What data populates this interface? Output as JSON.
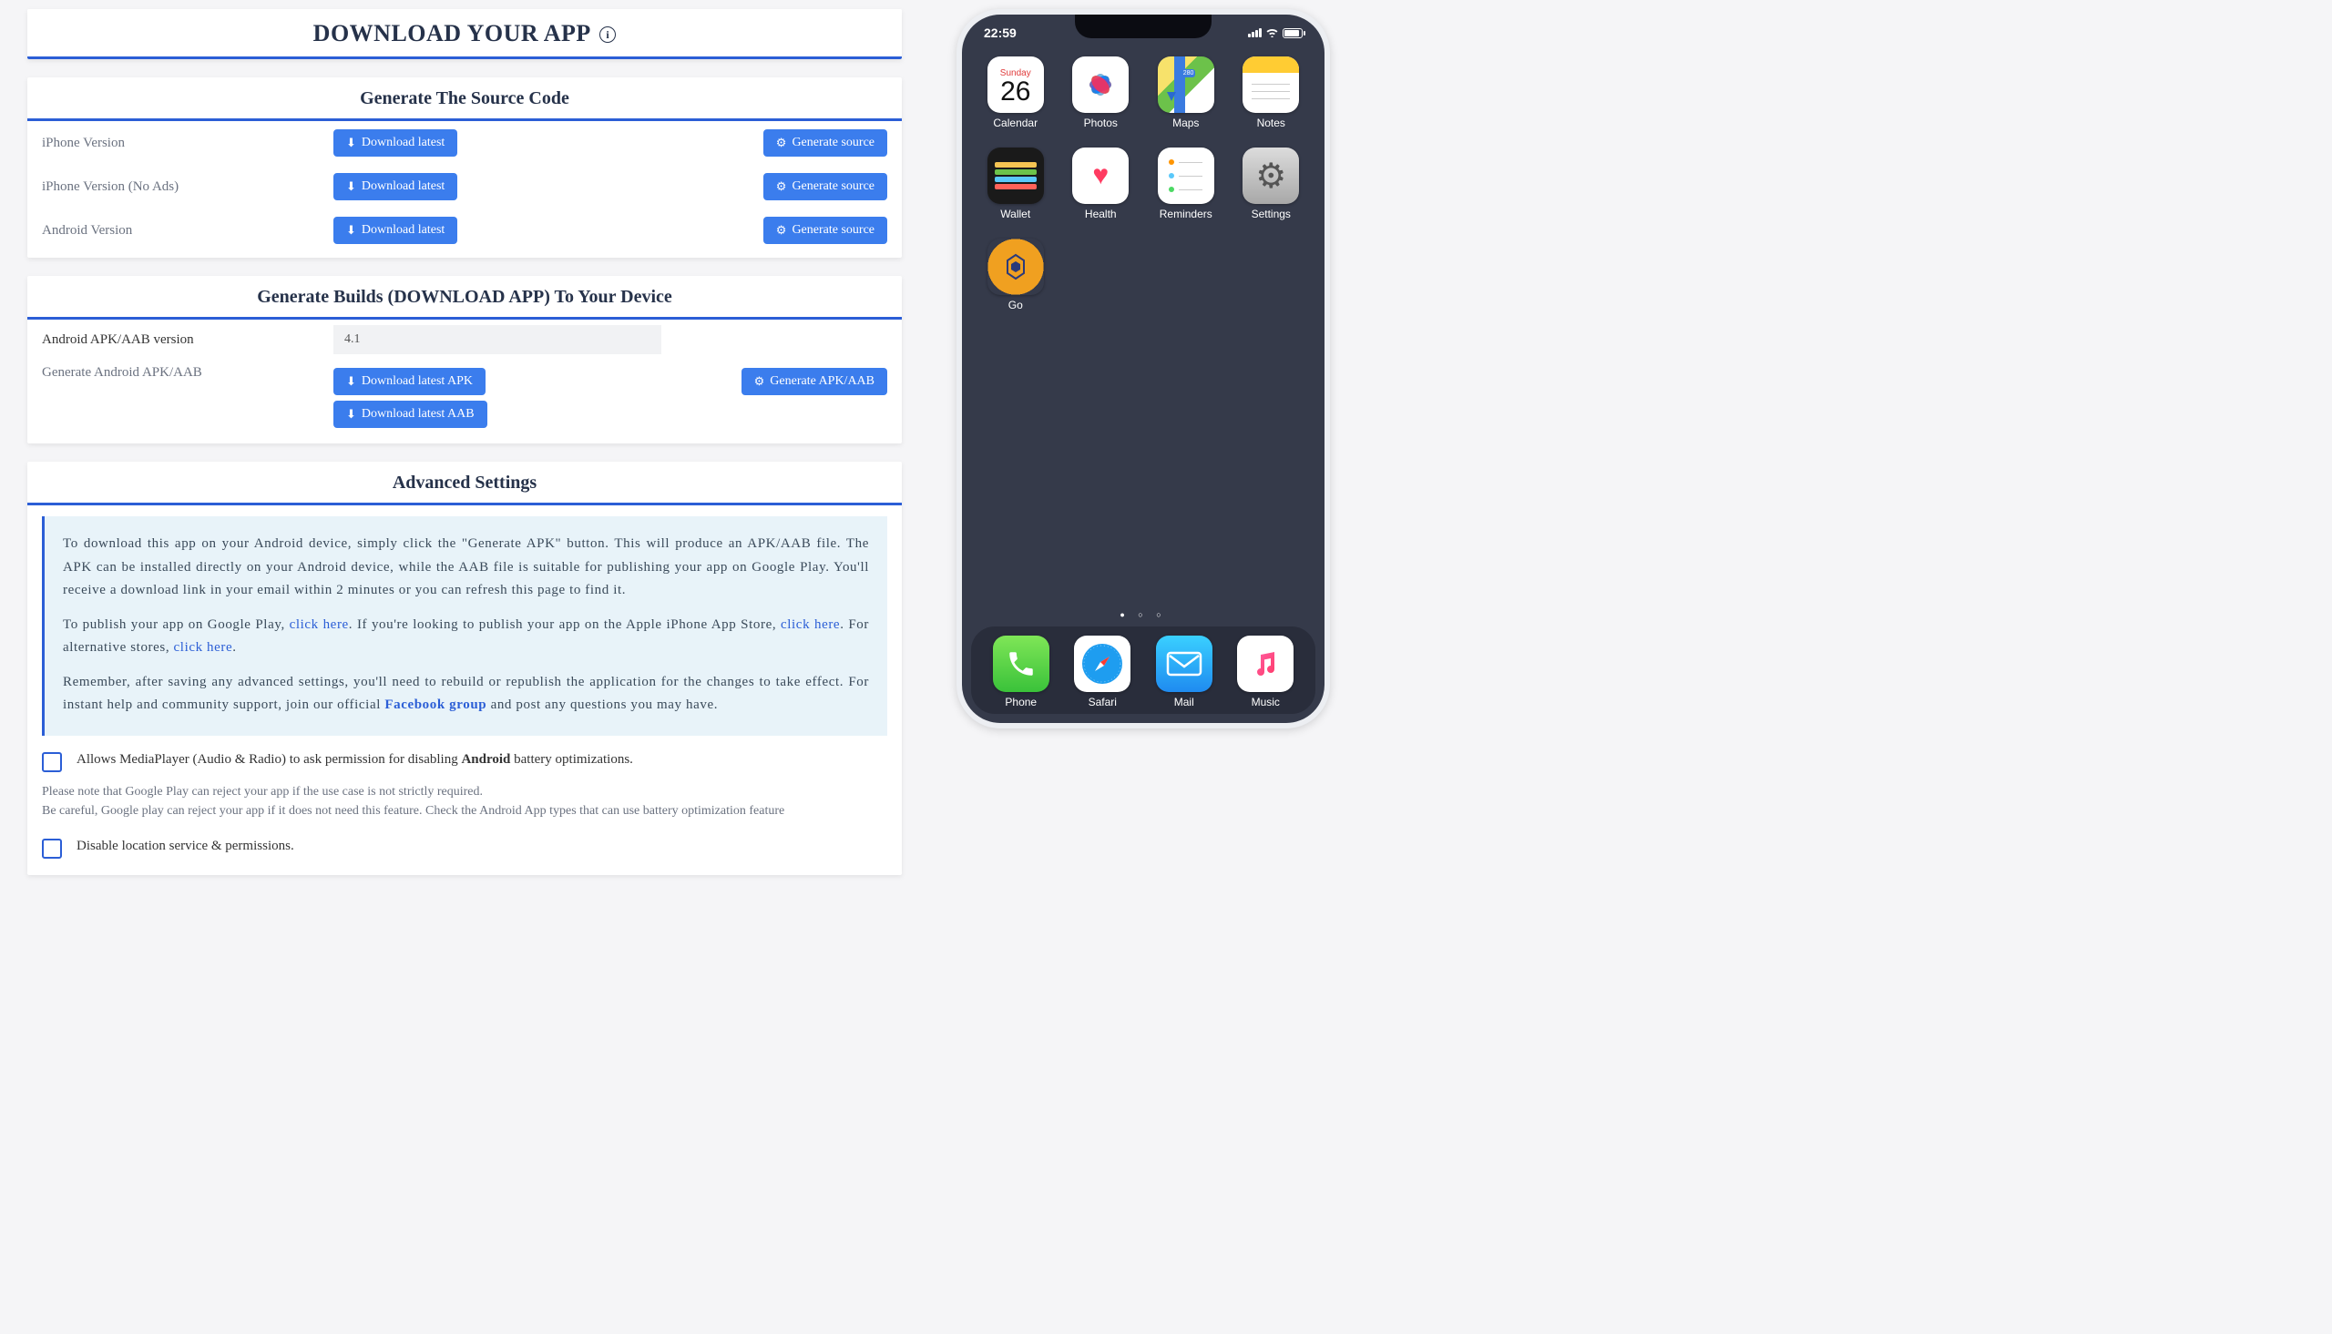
{
  "page_title": "DOWNLOAD YOUR APP",
  "sections": {
    "source": {
      "header": "Generate The Source Code",
      "rows": [
        {
          "label": "iPhone Version",
          "download": "Download latest",
          "generate": "Generate source"
        },
        {
          "label": "iPhone Version (No Ads)",
          "download": "Download latest",
          "generate": "Generate source"
        },
        {
          "label": "Android Version",
          "download": "Download latest",
          "generate": "Generate source"
        }
      ]
    },
    "builds": {
      "header": "Generate Builds (DOWNLOAD APP) To Your Device",
      "version_label": "Android APK/AAB version",
      "version_value": "4.1",
      "generate_label": "Generate Android APK/AAB",
      "download_apk": "Download latest APK",
      "download_aab": "Download latest AAB",
      "generate_btn": "Generate APK/AAB"
    },
    "advanced": {
      "header": "Advanced Settings",
      "info_p1": "To download this app on your Android device, simply click the \"Generate APK\" button. This will produce an APK/AAB file. The APK can be installed directly on your Android device, while the AAB file is suitable for publishing your app on Google Play. You'll receive a download link in your email within 2 minutes or you can refresh this page to find it.",
      "info_p2a": "To publish your app on Google Play, ",
      "link_here": "click here",
      "info_p2b": ". If you're looking to publish your app on the Apple iPhone App Store, ",
      "info_p2c": ". For alternative stores, ",
      "period": ".",
      "info_p3a": "Remember, after saving any advanced settings, you'll need to rebuild or republish the application for the changes to take effect. For instant help and community support, join our official ",
      "fb_group": "Facebook group",
      "info_p3b": " and post any questions you may have.",
      "check1a": "Allows MediaPlayer (Audio & Radio) to ask permission for disabling ",
      "check1_bold": "Android",
      "check1b": " battery optimizations.",
      "note1": "Please note that Google Play can reject your app if the use case is not strictly required.",
      "note2": "Be careful, Google play can reject your app if it does not need this feature. Check the Android App types that can use battery optimization feature",
      "check2": "Disable location service & permissions."
    }
  },
  "phone": {
    "time": "22:59",
    "calendar": {
      "day": "Sunday",
      "num": "26"
    },
    "apps_row1": [
      "Calendar",
      "Photos",
      "Maps",
      "Notes"
    ],
    "apps_row2": [
      "Wallet",
      "Health",
      "Reminders",
      "Settings"
    ],
    "apps_row3": [
      "Go"
    ],
    "dock": [
      "Phone",
      "Safari",
      "Mail",
      "Music"
    ]
  }
}
